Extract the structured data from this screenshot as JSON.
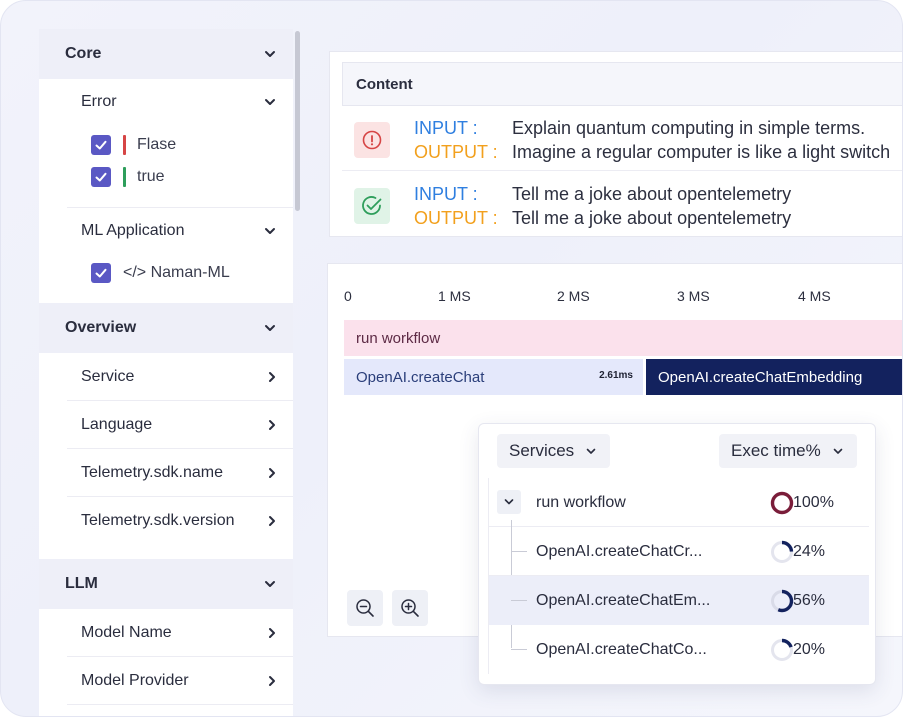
{
  "sidebar": {
    "core": {
      "title": "Core",
      "error": {
        "title": "Error",
        "options": [
          {
            "label": "Flase",
            "checked": true,
            "marker_color": "#d64545"
          },
          {
            "label": "true",
            "checked": true,
            "marker_color": "#2e9e5b"
          }
        ]
      },
      "ml_application": {
        "title": "ML Application",
        "options": [
          {
            "label": "</> Naman-ML",
            "checked": true
          }
        ]
      }
    },
    "overview": {
      "title": "Overview",
      "items": [
        "Service",
        "Language",
        "Telemetry.sdk.name",
        "Telemetry.sdk.version"
      ]
    },
    "llm": {
      "title": "LLM",
      "items": [
        "Model Name",
        "Model Provider"
      ]
    }
  },
  "content": {
    "header": "Content",
    "rows": [
      {
        "status": "error",
        "input_label": "INPUT :",
        "output_label": "OUTPUT :",
        "input": "Explain quantum computing in simple terms.",
        "output": "Imagine a regular computer is like a light switch"
      },
      {
        "status": "success",
        "input_label": "INPUT :",
        "output_label": "OUTPUT :",
        "input": "Tell me a joke about opentelemetry",
        "output": "Tell me a joke about opentelemetry"
      }
    ]
  },
  "timeline": {
    "ticks": [
      "0",
      "1 MS",
      "2 MS",
      "3 MS",
      "4 MS"
    ],
    "spans": {
      "run": "run workflow",
      "chat": "OpenAI.createChat",
      "chat_duration": "2.61ms",
      "embed": "OpenAI.createChatEmbedding"
    }
  },
  "services": {
    "group_by": "Services",
    "sort_by": "Exec time%",
    "rows": [
      {
        "name": "run workflow",
        "pct_label": "100%",
        "pct": 100,
        "root": true
      },
      {
        "name": "OpenAI.createChatCr...",
        "pct_label": "24%",
        "pct": 24
      },
      {
        "name": "OpenAI.createChatEm...",
        "pct_label": "56%",
        "pct": 56,
        "selected": true
      },
      {
        "name": "OpenAI.createChatCo...",
        "pct_label": "20%",
        "pct": 20
      }
    ]
  },
  "colors": {
    "accent": "#5a58c4",
    "input_label": "#2f7fe0",
    "output_label": "#f2a01d",
    "error": "#d64545",
    "success": "#2e9e5b",
    "ring_root": "#7a1d3a",
    "ring": "#13225e",
    "run_span": "#fbe1ec",
    "chat_span": "#e4e8fb",
    "embed_span": "#13225e"
  }
}
